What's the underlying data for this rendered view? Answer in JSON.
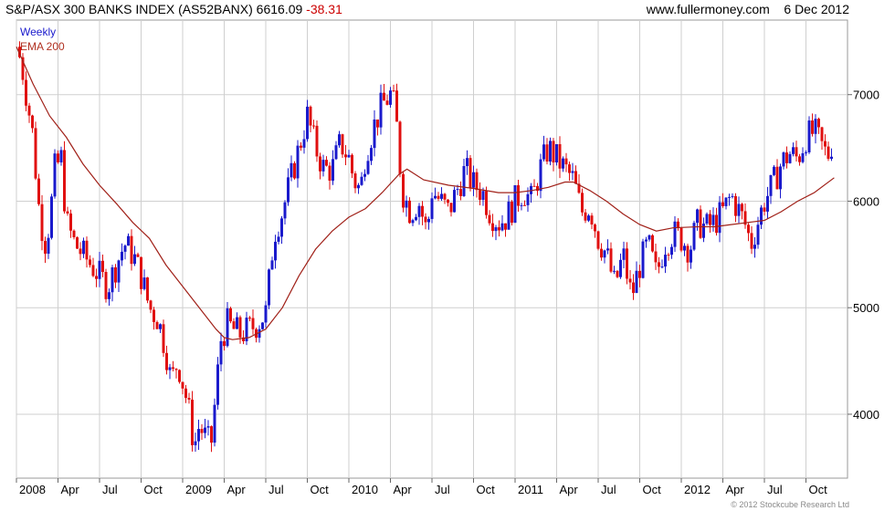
{
  "header": {
    "title": "S&P/ASX 300 BANKS INDEX (AS52BANX) 6616.09",
    "change": "-38.31",
    "website": "www.fullermoney.com",
    "date": "6 Dec 2012"
  },
  "legend": {
    "weekly": "Weekly",
    "ema": "EMA 200"
  },
  "copyright": "© 2012 Stockcube Research Ltd",
  "colors": {
    "up": "#1a1acc",
    "down": "#e01010",
    "ema": "#a02018",
    "grid": "#cfcfcf",
    "frame": "#999999"
  },
  "chart_data": {
    "type": "candlestick-weekly",
    "price_range": [
      3400,
      7700
    ],
    "y_ticks": [
      4000,
      5000,
      6000,
      7000
    ],
    "x_range": [
      2008.0,
      2013.0
    ],
    "x_ticks": [
      {
        "label": "2008",
        "t": 2008.0
      },
      {
        "label": "Apr",
        "t": 2008.25
      },
      {
        "label": "Jul",
        "t": 2008.5
      },
      {
        "label": "Oct",
        "t": 2008.75
      },
      {
        "label": "2009",
        "t": 2009.0
      },
      {
        "label": "Apr",
        "t": 2009.25
      },
      {
        "label": "Jul",
        "t": 2009.5
      },
      {
        "label": "Oct",
        "t": 2009.75
      },
      {
        "label": "2010",
        "t": 2010.0
      },
      {
        "label": "Apr",
        "t": 2010.25
      },
      {
        "label": "Jul",
        "t": 2010.5
      },
      {
        "label": "Oct",
        "t": 2010.75
      },
      {
        "label": "2011",
        "t": 2011.0
      },
      {
        "label": "Apr",
        "t": 2011.25
      },
      {
        "label": "Jul",
        "t": 2011.5
      },
      {
        "label": "Oct",
        "t": 2011.75
      },
      {
        "label": "2012",
        "t": 2012.0
      },
      {
        "label": "Apr",
        "t": 2012.25
      },
      {
        "label": "Jul",
        "t": 2012.5
      },
      {
        "label": "Oct",
        "t": 2012.75
      }
    ],
    "close_path": [
      [
        2008.0,
        7450
      ],
      [
        2008.03,
        7300
      ],
      [
        2008.07,
        6900
      ],
      [
        2008.1,
        6600
      ],
      [
        2008.13,
        6000
      ],
      [
        2008.17,
        5600
      ],
      [
        2008.2,
        5800
      ],
      [
        2008.23,
        6300
      ],
      [
        2008.27,
        6400
      ],
      [
        2008.3,
        5800
      ],
      [
        2008.35,
        5600
      ],
      [
        2008.4,
        5500
      ],
      [
        2008.45,
        5400
      ],
      [
        2008.5,
        5300
      ],
      [
        2008.55,
        5200
      ],
      [
        2008.6,
        5400
      ],
      [
        2008.65,
        5600
      ],
      [
        2008.7,
        5500
      ],
      [
        2008.75,
        5300
      ],
      [
        2008.8,
        5000
      ],
      [
        2008.85,
        4900
      ],
      [
        2008.9,
        4600
      ],
      [
        2008.93,
        4300
      ],
      [
        2008.97,
        4500
      ],
      [
        2009.0,
        4300
      ],
      [
        2009.03,
        4100
      ],
      [
        2009.07,
        3700
      ],
      [
        2009.1,
        3900
      ],
      [
        2009.13,
        3800
      ],
      [
        2009.17,
        3700
      ],
      [
        2009.2,
        4200
      ],
      [
        2009.23,
        4700
      ],
      [
        2009.27,
        4850
      ],
      [
        2009.3,
        4800
      ],
      [
        2009.35,
        4750
      ],
      [
        2009.4,
        4800
      ],
      [
        2009.45,
        4850
      ],
      [
        2009.5,
        4950
      ],
      [
        2009.55,
        5700
      ],
      [
        2009.6,
        5900
      ],
      [
        2009.65,
        6200
      ],
      [
        2009.7,
        6500
      ],
      [
        2009.75,
        6800
      ],
      [
        2009.8,
        6500
      ],
      [
        2009.85,
        6300
      ],
      [
        2009.9,
        6300
      ],
      [
        2009.95,
        6550
      ],
      [
        2010.0,
        6400
      ],
      [
        2010.03,
        6200
      ],
      [
        2010.07,
        6100
      ],
      [
        2010.1,
        6450
      ],
      [
        2010.15,
        6700
      ],
      [
        2010.2,
        6900
      ],
      [
        2010.25,
        7000
      ],
      [
        2010.28,
        6850
      ],
      [
        2010.32,
        6100
      ],
      [
        2010.37,
        5900
      ],
      [
        2010.42,
        6000
      ],
      [
        2010.47,
        5700
      ],
      [
        2010.5,
        6100
      ],
      [
        2010.55,
        6000
      ],
      [
        2010.6,
        5900
      ],
      [
        2010.65,
        6100
      ],
      [
        2010.7,
        6300
      ],
      [
        2010.75,
        6150
      ],
      [
        2010.8,
        6100
      ],
      [
        2010.85,
        5900
      ],
      [
        2010.9,
        5800
      ],
      [
        2010.95,
        5850
      ],
      [
        2011.0,
        6000
      ],
      [
        2011.05,
        6100
      ],
      [
        2011.1,
        6000
      ],
      [
        2011.15,
        6300
      ],
      [
        2011.2,
        6500
      ],
      [
        2011.25,
        6400
      ],
      [
        2011.3,
        6300
      ],
      [
        2011.35,
        6200
      ],
      [
        2011.4,
        5900
      ],
      [
        2011.45,
        5950
      ],
      [
        2011.5,
        5650
      ],
      [
        2011.55,
        5500
      ],
      [
        2011.6,
        5200
      ],
      [
        2011.65,
        5500
      ],
      [
        2011.7,
        5100
      ],
      [
        2011.75,
        5400
      ],
      [
        2011.8,
        5600
      ],
      [
        2011.85,
        5300
      ],
      [
        2011.9,
        5600
      ],
      [
        2011.95,
        5700
      ],
      [
        2012.0,
        5650
      ],
      [
        2012.05,
        5550
      ],
      [
        2012.1,
        5800
      ],
      [
        2012.15,
        5750
      ],
      [
        2012.2,
        5800
      ],
      [
        2012.25,
        5900
      ],
      [
        2012.3,
        6050
      ],
      [
        2012.35,
        5900
      ],
      [
        2012.38,
        5800
      ],
      [
        2012.42,
        5600
      ],
      [
        2012.45,
        5750
      ],
      [
        2012.5,
        6000
      ],
      [
        2012.55,
        6150
      ],
      [
        2012.6,
        6350
      ],
      [
        2012.65,
        6450
      ],
      [
        2012.7,
        6400
      ],
      [
        2012.75,
        6600
      ],
      [
        2012.8,
        6650
      ],
      [
        2012.85,
        6500
      ],
      [
        2012.88,
        6420
      ],
      [
        2012.92,
        6616
      ]
    ],
    "ema_path": [
      [
        2008.0,
        7450
      ],
      [
        2008.1,
        7100
      ],
      [
        2008.2,
        6800
      ],
      [
        2008.3,
        6600
      ],
      [
        2008.4,
        6350
      ],
      [
        2008.5,
        6150
      ],
      [
        2008.6,
        5980
      ],
      [
        2008.7,
        5800
      ],
      [
        2008.8,
        5650
      ],
      [
        2008.9,
        5400
      ],
      [
        2009.0,
        5200
      ],
      [
        2009.1,
        5000
      ],
      [
        2009.2,
        4800
      ],
      [
        2009.25,
        4720
      ],
      [
        2009.3,
        4700
      ],
      [
        2009.4,
        4720
      ],
      [
        2009.5,
        4800
      ],
      [
        2009.6,
        5000
      ],
      [
        2009.7,
        5300
      ],
      [
        2009.8,
        5550
      ],
      [
        2009.9,
        5720
      ],
      [
        2010.0,
        5850
      ],
      [
        2010.1,
        5930
      ],
      [
        2010.2,
        6080
      ],
      [
        2010.3,
        6250
      ],
      [
        2010.35,
        6300
      ],
      [
        2010.45,
        6200
      ],
      [
        2010.6,
        6150
      ],
      [
        2010.75,
        6120
      ],
      [
        2010.9,
        6080
      ],
      [
        2011.0,
        6080
      ],
      [
        2011.1,
        6100
      ],
      [
        2011.2,
        6130
      ],
      [
        2011.3,
        6180
      ],
      [
        2011.35,
        6180
      ],
      [
        2011.45,
        6100
      ],
      [
        2011.55,
        6000
      ],
      [
        2011.65,
        5880
      ],
      [
        2011.75,
        5780
      ],
      [
        2011.85,
        5720
      ],
      [
        2011.95,
        5750
      ],
      [
        2012.1,
        5760
      ],
      [
        2012.2,
        5760
      ],
      [
        2012.3,
        5780
      ],
      [
        2012.4,
        5800
      ],
      [
        2012.5,
        5820
      ],
      [
        2012.6,
        5900
      ],
      [
        2012.7,
        6000
      ],
      [
        2012.8,
        6080
      ],
      [
        2012.92,
        6220
      ]
    ]
  }
}
